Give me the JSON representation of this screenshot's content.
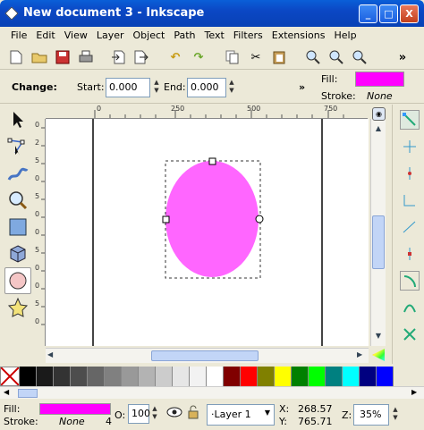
{
  "window": {
    "title": "New document 3 - Inkscape",
    "buttons": [
      "_",
      "□",
      "X"
    ]
  },
  "menu": [
    "File",
    "Edit",
    "View",
    "Layer",
    "Object",
    "Path",
    "Text",
    "Filters",
    "Extensions",
    "Help"
  ],
  "command_bar": {
    "icons": [
      "new-icon",
      "open-icon",
      "save-icon",
      "print-icon",
      "import-icon",
      "export-icon",
      "undo-icon",
      "redo-icon",
      "copy-icon",
      "cut-icon",
      "paste-icon",
      "zoom-selection-icon",
      "zoom-drawing-icon",
      "zoom-page-icon"
    ],
    "more": "»"
  },
  "tool_controls": {
    "change_label": "Change:",
    "start_label": "Start:",
    "start_value": "0.000",
    "end_label": "End:",
    "end_value": "0.000",
    "more": "»",
    "fill_label": "Fill:",
    "stroke_label": "Stroke:",
    "stroke_value": "None",
    "fill_color": "#ff00ff"
  },
  "toolbox": [
    "selector-icon",
    "node-editor-icon",
    "tweak-icon",
    "zoom-icon",
    "rectangle-icon",
    "3d-box-icon",
    "ellipse-icon",
    "star-icon"
  ],
  "ruler": {
    "h_labels": [
      "0",
      "250",
      "500",
      "750"
    ],
    "v_labels": [
      "0",
      "2",
      "5",
      "0",
      "5",
      "0",
      "0",
      "5",
      "0",
      "0",
      "5",
      "0"
    ]
  },
  "canvas": {
    "shape": "ellipse",
    "fill": "#ff66ff"
  },
  "palette": [
    "#000000",
    "#1a1a1a",
    "#333333",
    "#4d4d4d",
    "#666666",
    "#808080",
    "#999999",
    "#b3b3b3",
    "#cccccc",
    "#e6e6e6",
    "#f2f2f2",
    "#ffffff",
    "#800000",
    "#ff0000",
    "#808000",
    "#ffff00",
    "#008000",
    "#00ff00",
    "#008080",
    "#00ffff",
    "#000080",
    "#0000ff"
  ],
  "status": {
    "fill_label": "Fill:",
    "stroke_label": "Stroke:",
    "stroke_value": "None",
    "stroke_width": "4",
    "opacity_label": "O:",
    "opacity_value": "100",
    "layer_value": "·Layer 1",
    "x_label": "X:",
    "x_value": "268.57",
    "y_label": "Y:",
    "y_value": "765.71",
    "zoom_label": "Z:",
    "zoom_value": "35%"
  }
}
